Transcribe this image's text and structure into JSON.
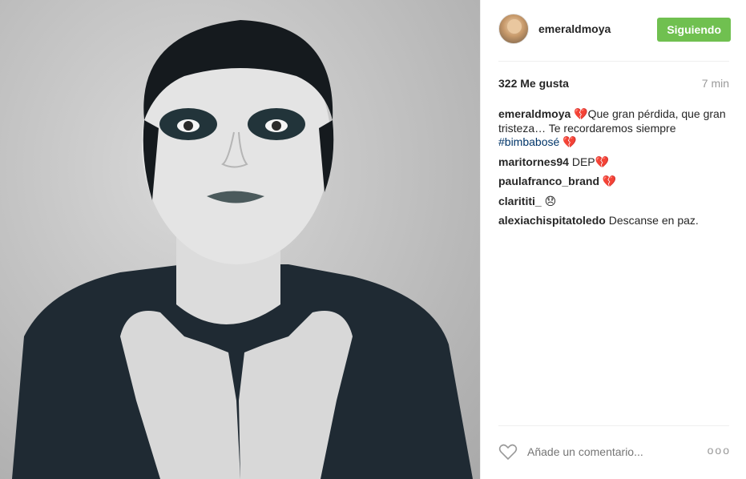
{
  "post": {
    "username": "emeraldmoya",
    "follow_label": "Siguiendo",
    "likes": "322 Me gusta",
    "time": "7 min"
  },
  "comments": [
    {
      "user": "emeraldmoya",
      "text": "💔Que gran pérdida, que gran tristeza… Te recordaremos siempre",
      "hashtag": "#bimbabosé",
      "trailing": " 💔"
    },
    {
      "user": "maritornes94",
      "text": " DEP💔"
    },
    {
      "user": "paulafranco_brand",
      "text": " 💔"
    },
    {
      "user": "clarititi_",
      "text": " 😞"
    },
    {
      "user": "alexiachispitatoledo",
      "text": " Descanse en paz."
    }
  ],
  "footer": {
    "comment_placeholder": "Añade un comentario...",
    "more_label": "ooo"
  },
  "colors": {
    "follow_button": "#70c050",
    "hashtag": "#003569",
    "muted": "#999999"
  },
  "icons": {
    "like": "heart-outline-icon",
    "more": "more-options-icon"
  }
}
